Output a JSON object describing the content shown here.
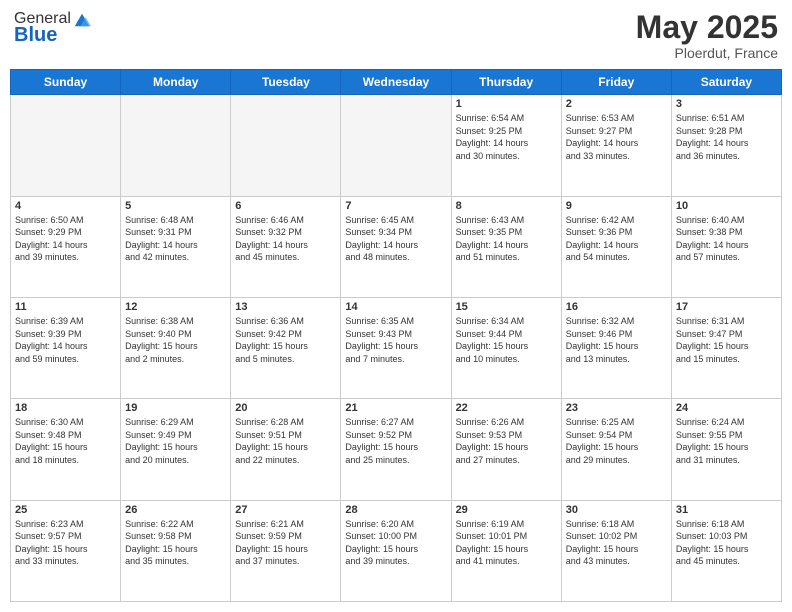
{
  "header": {
    "logo_general": "General",
    "logo_blue": "Blue",
    "month": "May 2025",
    "location": "Ploerdut, France"
  },
  "days_of_week": [
    "Sunday",
    "Monday",
    "Tuesday",
    "Wednesday",
    "Thursday",
    "Friday",
    "Saturday"
  ],
  "weeks": [
    [
      {
        "num": "",
        "info": "",
        "empty": true
      },
      {
        "num": "",
        "info": "",
        "empty": true
      },
      {
        "num": "",
        "info": "",
        "empty": true
      },
      {
        "num": "",
        "info": "",
        "empty": true
      },
      {
        "num": "1",
        "info": "Sunrise: 6:54 AM\nSunset: 9:25 PM\nDaylight: 14 hours\nand 30 minutes.",
        "empty": false
      },
      {
        "num": "2",
        "info": "Sunrise: 6:53 AM\nSunset: 9:27 PM\nDaylight: 14 hours\nand 33 minutes.",
        "empty": false
      },
      {
        "num": "3",
        "info": "Sunrise: 6:51 AM\nSunset: 9:28 PM\nDaylight: 14 hours\nand 36 minutes.",
        "empty": false
      }
    ],
    [
      {
        "num": "4",
        "info": "Sunrise: 6:50 AM\nSunset: 9:29 PM\nDaylight: 14 hours\nand 39 minutes.",
        "empty": false
      },
      {
        "num": "5",
        "info": "Sunrise: 6:48 AM\nSunset: 9:31 PM\nDaylight: 14 hours\nand 42 minutes.",
        "empty": false
      },
      {
        "num": "6",
        "info": "Sunrise: 6:46 AM\nSunset: 9:32 PM\nDaylight: 14 hours\nand 45 minutes.",
        "empty": false
      },
      {
        "num": "7",
        "info": "Sunrise: 6:45 AM\nSunset: 9:34 PM\nDaylight: 14 hours\nand 48 minutes.",
        "empty": false
      },
      {
        "num": "8",
        "info": "Sunrise: 6:43 AM\nSunset: 9:35 PM\nDaylight: 14 hours\nand 51 minutes.",
        "empty": false
      },
      {
        "num": "9",
        "info": "Sunrise: 6:42 AM\nSunset: 9:36 PM\nDaylight: 14 hours\nand 54 minutes.",
        "empty": false
      },
      {
        "num": "10",
        "info": "Sunrise: 6:40 AM\nSunset: 9:38 PM\nDaylight: 14 hours\nand 57 minutes.",
        "empty": false
      }
    ],
    [
      {
        "num": "11",
        "info": "Sunrise: 6:39 AM\nSunset: 9:39 PM\nDaylight: 14 hours\nand 59 minutes.",
        "empty": false
      },
      {
        "num": "12",
        "info": "Sunrise: 6:38 AM\nSunset: 9:40 PM\nDaylight: 15 hours\nand 2 minutes.",
        "empty": false
      },
      {
        "num": "13",
        "info": "Sunrise: 6:36 AM\nSunset: 9:42 PM\nDaylight: 15 hours\nand 5 minutes.",
        "empty": false
      },
      {
        "num": "14",
        "info": "Sunrise: 6:35 AM\nSunset: 9:43 PM\nDaylight: 15 hours\nand 7 minutes.",
        "empty": false
      },
      {
        "num": "15",
        "info": "Sunrise: 6:34 AM\nSunset: 9:44 PM\nDaylight: 15 hours\nand 10 minutes.",
        "empty": false
      },
      {
        "num": "16",
        "info": "Sunrise: 6:32 AM\nSunset: 9:46 PM\nDaylight: 15 hours\nand 13 minutes.",
        "empty": false
      },
      {
        "num": "17",
        "info": "Sunrise: 6:31 AM\nSunset: 9:47 PM\nDaylight: 15 hours\nand 15 minutes.",
        "empty": false
      }
    ],
    [
      {
        "num": "18",
        "info": "Sunrise: 6:30 AM\nSunset: 9:48 PM\nDaylight: 15 hours\nand 18 minutes.",
        "empty": false
      },
      {
        "num": "19",
        "info": "Sunrise: 6:29 AM\nSunset: 9:49 PM\nDaylight: 15 hours\nand 20 minutes.",
        "empty": false
      },
      {
        "num": "20",
        "info": "Sunrise: 6:28 AM\nSunset: 9:51 PM\nDaylight: 15 hours\nand 22 minutes.",
        "empty": false
      },
      {
        "num": "21",
        "info": "Sunrise: 6:27 AM\nSunset: 9:52 PM\nDaylight: 15 hours\nand 25 minutes.",
        "empty": false
      },
      {
        "num": "22",
        "info": "Sunrise: 6:26 AM\nSunset: 9:53 PM\nDaylight: 15 hours\nand 27 minutes.",
        "empty": false
      },
      {
        "num": "23",
        "info": "Sunrise: 6:25 AM\nSunset: 9:54 PM\nDaylight: 15 hours\nand 29 minutes.",
        "empty": false
      },
      {
        "num": "24",
        "info": "Sunrise: 6:24 AM\nSunset: 9:55 PM\nDaylight: 15 hours\nand 31 minutes.",
        "empty": false
      }
    ],
    [
      {
        "num": "25",
        "info": "Sunrise: 6:23 AM\nSunset: 9:57 PM\nDaylight: 15 hours\nand 33 minutes.",
        "empty": false
      },
      {
        "num": "26",
        "info": "Sunrise: 6:22 AM\nSunset: 9:58 PM\nDaylight: 15 hours\nand 35 minutes.",
        "empty": false
      },
      {
        "num": "27",
        "info": "Sunrise: 6:21 AM\nSunset: 9:59 PM\nDaylight: 15 hours\nand 37 minutes.",
        "empty": false
      },
      {
        "num": "28",
        "info": "Sunrise: 6:20 AM\nSunset: 10:00 PM\nDaylight: 15 hours\nand 39 minutes.",
        "empty": false
      },
      {
        "num": "29",
        "info": "Sunrise: 6:19 AM\nSunset: 10:01 PM\nDaylight: 15 hours\nand 41 minutes.",
        "empty": false
      },
      {
        "num": "30",
        "info": "Sunrise: 6:18 AM\nSunset: 10:02 PM\nDaylight: 15 hours\nand 43 minutes.",
        "empty": false
      },
      {
        "num": "31",
        "info": "Sunrise: 6:18 AM\nSunset: 10:03 PM\nDaylight: 15 hours\nand 45 minutes.",
        "empty": false
      }
    ]
  ]
}
